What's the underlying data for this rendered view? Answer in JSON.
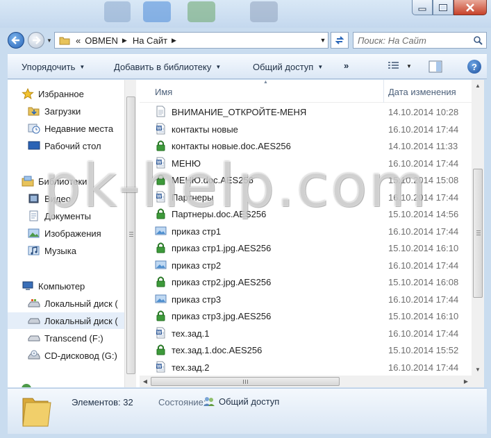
{
  "window": {
    "caption_buttons": [
      "minimize-icon",
      "maximize-icon",
      "close-icon"
    ]
  },
  "address_bar": {
    "overflow": "«",
    "segments": [
      "OBMEN",
      "На Сайт"
    ],
    "search_placeholder": "Поиск: На Сайт"
  },
  "toolbar": {
    "organize": "Упорядочить",
    "add_to_library": "Добавить в библиотеку",
    "share": "Общий доступ",
    "more": "»",
    "help": "?"
  },
  "nav": {
    "items": [
      {
        "label": "Избранное",
        "icon": "star-icon"
      },
      {
        "label": "Загрузки",
        "icon": "downloads-folder-icon"
      },
      {
        "label": "Недавние места",
        "icon": "recent-places-icon"
      },
      {
        "label": "Рабочий стол",
        "icon": "desktop-icon"
      },
      {
        "label": "Библиотеки",
        "icon": "libraries-icon"
      },
      {
        "label": "Видео",
        "icon": "video-library-icon"
      },
      {
        "label": "Документы",
        "icon": "documents-library-icon"
      },
      {
        "label": "Изображения",
        "icon": "pictures-library-icon"
      },
      {
        "label": "Музыка",
        "icon": "music-library-icon"
      },
      {
        "label": "Компьютер",
        "icon": "computer-icon"
      },
      {
        "label": "Локальный диск (",
        "icon": "system-drive-icon"
      },
      {
        "label": "Локальный диск (",
        "icon": "drive-icon"
      },
      {
        "label": "Transcend (F:)",
        "icon": "removable-drive-icon"
      },
      {
        "label": "CD-дисковод (G:)",
        "icon": "cd-drive-icon"
      }
    ]
  },
  "columns": {
    "name": "Имя",
    "date": "Дата изменения"
  },
  "files": [
    {
      "name": "ВНИМАНИЕ_ОТКРОЙТЕ-МЕНЯ",
      "date": "14.10.2014 10:28",
      "icon": "text-file-icon"
    },
    {
      "name": "контакты новые",
      "date": "16.10.2014 17:44",
      "icon": "word-doc-icon"
    },
    {
      "name": "контакты новые.doc.AES256",
      "date": "14.10.2014 11:33",
      "icon": "encrypted-lock-icon"
    },
    {
      "name": "МЕНЮ",
      "date": "16.10.2014 17:44",
      "icon": "word-doc-icon"
    },
    {
      "name": "МЕНЮ.doc.AES256",
      "date": "15.10.2014 15:08",
      "icon": "encrypted-lock-icon"
    },
    {
      "name": "Партнеры",
      "date": "16.10.2014 17:44",
      "icon": "word-doc-icon"
    },
    {
      "name": "Партнеры.doc.AES256",
      "date": "15.10.2014 14:56",
      "icon": "encrypted-lock-icon"
    },
    {
      "name": "приказ стр1",
      "date": "16.10.2014 17:44",
      "icon": "image-file-icon"
    },
    {
      "name": "приказ стр1.jpg.AES256",
      "date": "15.10.2014 16:10",
      "icon": "encrypted-lock-icon"
    },
    {
      "name": "приказ стр2",
      "date": "16.10.2014 17:44",
      "icon": "image-file-icon"
    },
    {
      "name": "приказ стр2.jpg.AES256",
      "date": "15.10.2014 16:08",
      "icon": "encrypted-lock-icon"
    },
    {
      "name": "приказ стр3",
      "date": "16.10.2014 17:44",
      "icon": "image-file-icon"
    },
    {
      "name": "приказ стр3.jpg.AES256",
      "date": "15.10.2014 16:10",
      "icon": "encrypted-lock-icon"
    },
    {
      "name": "тех.зад.1",
      "date": "16.10.2014 17:44",
      "icon": "word-doc-icon"
    },
    {
      "name": "тех.зад.1.doc.AES256",
      "date": "15.10.2014 15:52",
      "icon": "encrypted-lock-icon"
    },
    {
      "name": "тех.зад.2",
      "date": "16.10.2014 17:44",
      "icon": "word-doc-icon"
    }
  ],
  "details": {
    "count": "Элементов: 32",
    "state_label": "Состояние:",
    "state_value": "Общий доступ"
  },
  "watermark": "pk-help.com",
  "colors": {
    "lock_green": "#3d9a3a",
    "accent_blue": "#2a66b8",
    "folder_yellow": "#e8c35a"
  }
}
